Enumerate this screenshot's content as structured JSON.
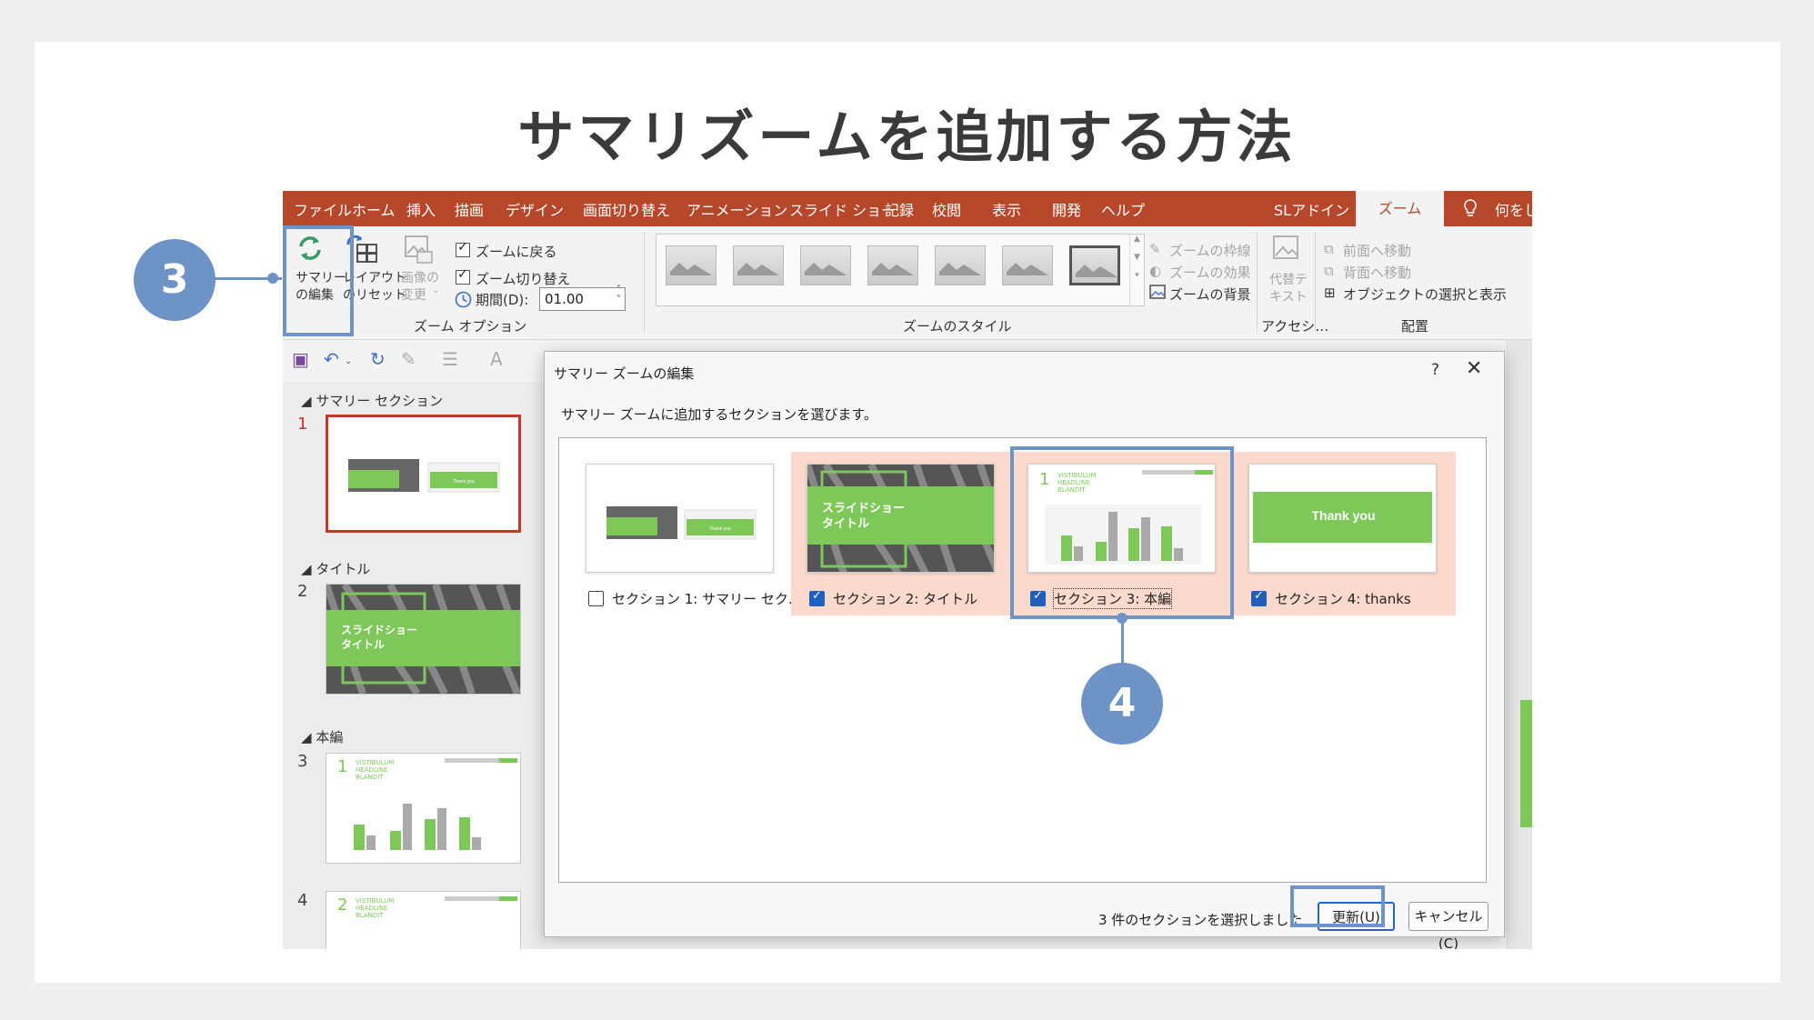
{
  "page_title": "サマリズームを追加する方法",
  "menubar": {
    "items": [
      "ファイル",
      "ホーム",
      "挿入",
      "描画",
      "デザイン",
      "画面切り替え",
      "アニメーション",
      "スライド ショー",
      "記録",
      "校閲",
      "表示",
      "開発",
      "ヘルプ",
      "SLアドイン"
    ],
    "active_tab": "ズーム",
    "tell_me": "何をし"
  },
  "ribbon": {
    "summary_edit": [
      "サマリー",
      "の編集"
    ],
    "layout_reset": [
      "レイアウト",
      "のリセット"
    ],
    "change_image": [
      "画像の",
      "変更"
    ],
    "zoom_return": "ズームに戻る",
    "zoom_transition": "ズーム切り替え",
    "period_label": "期間(D):",
    "period_value": "01.00",
    "group_zoom_options": "ズーム オプション",
    "zoom_border": "ズームの枠線",
    "zoom_effect": "ズームの効果",
    "zoom_background": "ズームの背景",
    "group_zoom_styles": "ズームのスタイル",
    "alt_text": [
      "代替テ",
      "キスト"
    ],
    "group_accessibility": "アクセシ…",
    "bring_forward": "前面へ移動",
    "send_backward": "背面へ移動",
    "selection_pane": "オブジェクトの選択と表示",
    "group_arrange": "配置"
  },
  "slide_panel": {
    "sections": [
      {
        "name": "サマリー セクション",
        "slide": "1"
      },
      {
        "name": "タイトル",
        "slide": "2"
      },
      {
        "name": "本編",
        "slide": "3"
      }
    ],
    "extra_slide": "4",
    "thumb_text": {
      "title_slide": [
        "スライドショー",
        "タイトル"
      ],
      "thank_you": "Thank you",
      "content_num1": "1",
      "content_num2": "2",
      "content_heading": [
        "VISTIBULUM",
        "HEADLINE",
        "BLANDIT"
      ]
    }
  },
  "dialog": {
    "title": "サマリー ズームの編集",
    "help": "?",
    "close": "✕",
    "instruction": "サマリー ズームに追加するセクションを選びます。",
    "sections": [
      {
        "label": "セクション 1: サマリー セク…",
        "checked": false
      },
      {
        "label": "セクション 2: タイトル",
        "checked": true
      },
      {
        "label": "セクション 3: 本編",
        "checked": true
      },
      {
        "label": "セクション 4: thanks",
        "checked": true
      }
    ],
    "status": "3 件のセクションを選択しました",
    "update_button": "更新(U)",
    "cancel_button": "キャンセル(C)"
  },
  "annotations": {
    "step3": "3",
    "step4": "4"
  },
  "colors": {
    "accent": "#b7472a",
    "green": "#7ec85a",
    "annotation": "#6e93c7",
    "checkbox": "#1f5fbf",
    "section_highlight": "#fbd9cd"
  }
}
